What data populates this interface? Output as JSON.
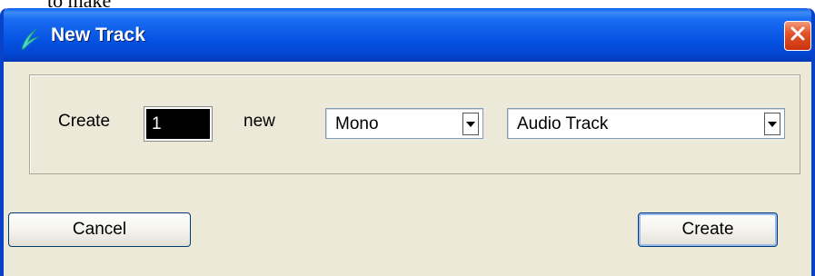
{
  "background_caption": "to make",
  "window": {
    "title": "New Track",
    "icon": "feather-app-icon",
    "close_icon": "close-icon"
  },
  "form": {
    "create_label": "Create",
    "count_value": "1",
    "new_label": "new",
    "channel_select": {
      "value": "Mono"
    },
    "track_type_select": {
      "value": "Audio Track"
    }
  },
  "buttons": {
    "cancel": "Cancel",
    "create": "Create"
  },
  "colors": {
    "titlebar": "#0553e2",
    "client_bg": "#ece9d8",
    "close_button": "#d9491c",
    "button_border": "#003c74"
  }
}
